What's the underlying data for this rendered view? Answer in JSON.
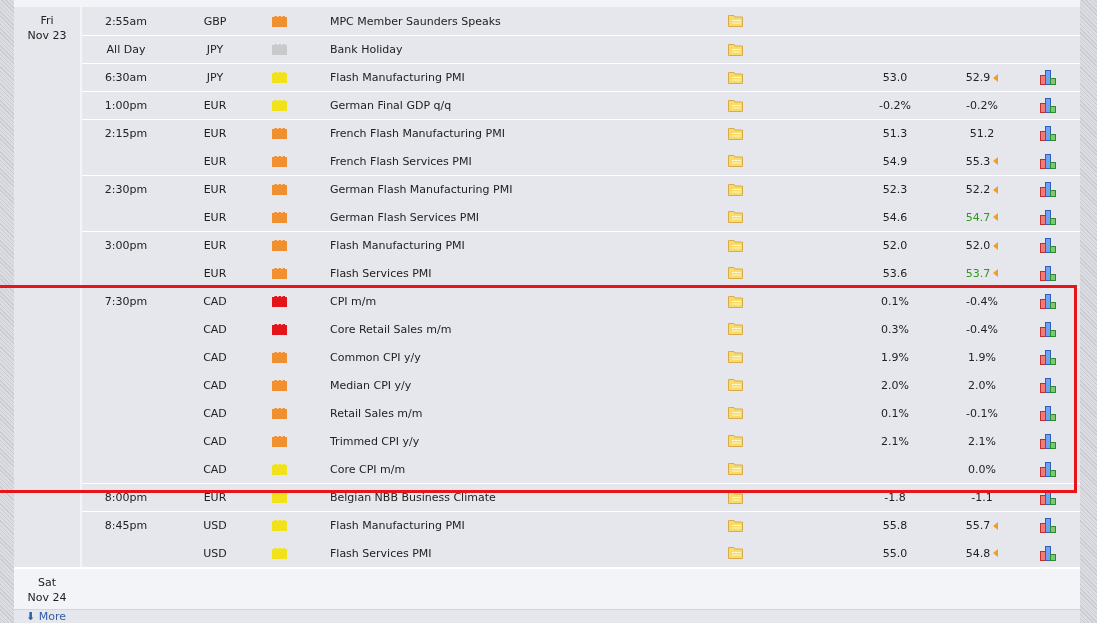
{
  "days": [
    {
      "weekday": "Fri",
      "date": "Nov 23",
      "events": [
        {
          "time": "2:55am",
          "currency": "GBP",
          "color": "#f0902f",
          "title": "MPC Member Saunders Speaks",
          "has_chart": false,
          "highlighted": false
        },
        {
          "time": "All Day",
          "currency": "JPY",
          "color": "#c9c9cc",
          "title": "Bank Holiday",
          "has_chart": false,
          "highlighted": false
        },
        {
          "time": "6:30am",
          "currency": "JPY",
          "color": "#f2e21c",
          "title": "Flash Manufacturing PMI",
          "forecast": "53.0",
          "previous": "52.9",
          "revised": true,
          "better": false,
          "has_chart": true,
          "highlighted": false
        },
        {
          "time": "1:00pm",
          "currency": "EUR",
          "color": "#f2e21c",
          "title": "German Final GDP q/q",
          "forecast": "-0.2%",
          "previous": "-0.2%",
          "revised": false,
          "better": false,
          "has_chart": true,
          "highlighted": false
        },
        {
          "time": "2:15pm",
          "currency": "EUR",
          "color": "#f0902f",
          "title": "French Flash Manufacturing PMI",
          "forecast": "51.3",
          "previous": "51.2",
          "revised": false,
          "better": false,
          "has_chart": true,
          "highlighted": false
        },
        {
          "currency": "EUR",
          "color": "#f0902f",
          "title": "French Flash Services PMI",
          "forecast": "54.9",
          "previous": "55.3",
          "revised": true,
          "better": false,
          "has_chart": true,
          "highlighted": false
        },
        {
          "time": "2:30pm",
          "currency": "EUR",
          "color": "#f0902f",
          "title": "German Flash Manufacturing PMI",
          "forecast": "52.3",
          "previous": "52.2",
          "revised": true,
          "better": false,
          "has_chart": true,
          "highlighted": false
        },
        {
          "currency": "EUR",
          "color": "#f0902f",
          "title": "German Flash Services PMI",
          "forecast": "54.6",
          "previous": "54.7",
          "revised": true,
          "better": true,
          "has_chart": true,
          "highlighted": false
        },
        {
          "time": "3:00pm",
          "currency": "EUR",
          "color": "#f0902f",
          "title": "Flash Manufacturing PMI",
          "forecast": "52.0",
          "previous": "52.0",
          "revised": true,
          "better": false,
          "has_chart": true,
          "highlighted": false
        },
        {
          "currency": "EUR",
          "color": "#f0902f",
          "title": "Flash Services PMI",
          "forecast": "53.6",
          "previous": "53.7",
          "revised": true,
          "better": true,
          "has_chart": true,
          "highlighted": false
        },
        {
          "time": "7:30pm",
          "currency": "CAD",
          "color": "#e4141b",
          "title": "CPI m/m",
          "forecast": "0.1%",
          "previous": "-0.4%",
          "revised": false,
          "better": false,
          "has_chart": true,
          "highlighted": true
        },
        {
          "currency": "CAD",
          "color": "#e4141b",
          "title": "Core Retail Sales m/m",
          "forecast": "0.3%",
          "previous": "-0.4%",
          "revised": false,
          "better": false,
          "has_chart": true,
          "highlighted": true
        },
        {
          "currency": "CAD",
          "color": "#f0902f",
          "title": "Common CPI y/y",
          "forecast": "1.9%",
          "previous": "1.9%",
          "revised": false,
          "better": false,
          "has_chart": true,
          "highlighted": true
        },
        {
          "currency": "CAD",
          "color": "#f0902f",
          "title": "Median CPI y/y",
          "forecast": "2.0%",
          "previous": "2.0%",
          "revised": false,
          "better": false,
          "has_chart": true,
          "highlighted": true
        },
        {
          "currency": "CAD",
          "color": "#f0902f",
          "title": "Retail Sales m/m",
          "forecast": "0.1%",
          "previous": "-0.1%",
          "revised": false,
          "better": false,
          "has_chart": true,
          "highlighted": true
        },
        {
          "currency": "CAD",
          "color": "#f0902f",
          "title": "Trimmed CPI y/y",
          "forecast": "2.1%",
          "previous": "2.1%",
          "revised": false,
          "better": false,
          "has_chart": true,
          "highlighted": true
        },
        {
          "currency": "CAD",
          "color": "#f2e21c",
          "title": "Core CPI m/m",
          "previous": "0.0%",
          "revised": false,
          "better": false,
          "has_chart": true,
          "highlighted": true
        },
        {
          "time": "8:00pm",
          "currency": "EUR",
          "color": "#f2e21c",
          "title": "Belgian NBB Business Climate",
          "forecast": "-1.8",
          "previous": "-1.1",
          "revised": false,
          "better": false,
          "has_chart": true,
          "highlighted": false
        },
        {
          "time": "8:45pm",
          "currency": "USD",
          "color": "#f2e21c",
          "title": "Flash Manufacturing PMI",
          "forecast": "55.8",
          "previous": "55.7",
          "revised": true,
          "better": false,
          "has_chart": true,
          "highlighted": false
        },
        {
          "currency": "USD",
          "color": "#f2e21c",
          "title": "Flash Services PMI",
          "forecast": "55.0",
          "previous": "54.8",
          "revised": true,
          "better": false,
          "has_chart": true,
          "highlighted": false
        }
      ]
    },
    {
      "weekday": "Sat",
      "date": "Nov 24"
    }
  ],
  "more_link": {
    "arrow": "⬇",
    "label": "More"
  }
}
